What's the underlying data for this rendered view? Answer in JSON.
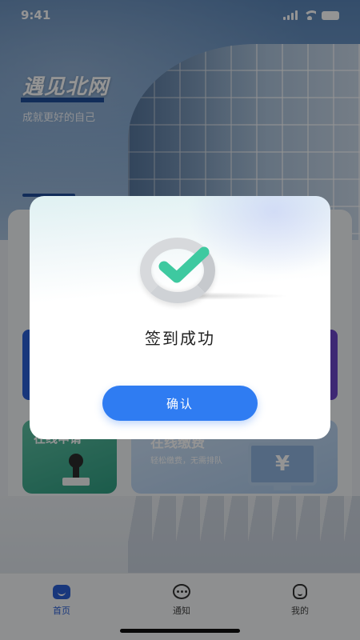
{
  "status_bar": {
    "time": "9:41"
  },
  "hero": {
    "slogan": "遇见北网",
    "tagline": "成就更好的自己"
  },
  "cards": {
    "left": {
      "title": "在线申请"
    },
    "right": {
      "title": "在线缴费",
      "subtitle": "轻松缴费，无需排队",
      "currency_symbol": "¥"
    }
  },
  "tabbar": {
    "items": [
      {
        "label": "首页",
        "icon": "home-icon",
        "active": true
      },
      {
        "label": "通知",
        "icon": "chat-icon",
        "active": false
      },
      {
        "label": "我的",
        "icon": "user-icon",
        "active": false
      }
    ]
  },
  "dialog": {
    "title": "签到成功",
    "confirm_label": "确认",
    "icon": "check-icon"
  },
  "colors": {
    "accent": "#2f7cf2",
    "check": "#3ec9a0",
    "active_tab": "#2a5fd6"
  }
}
